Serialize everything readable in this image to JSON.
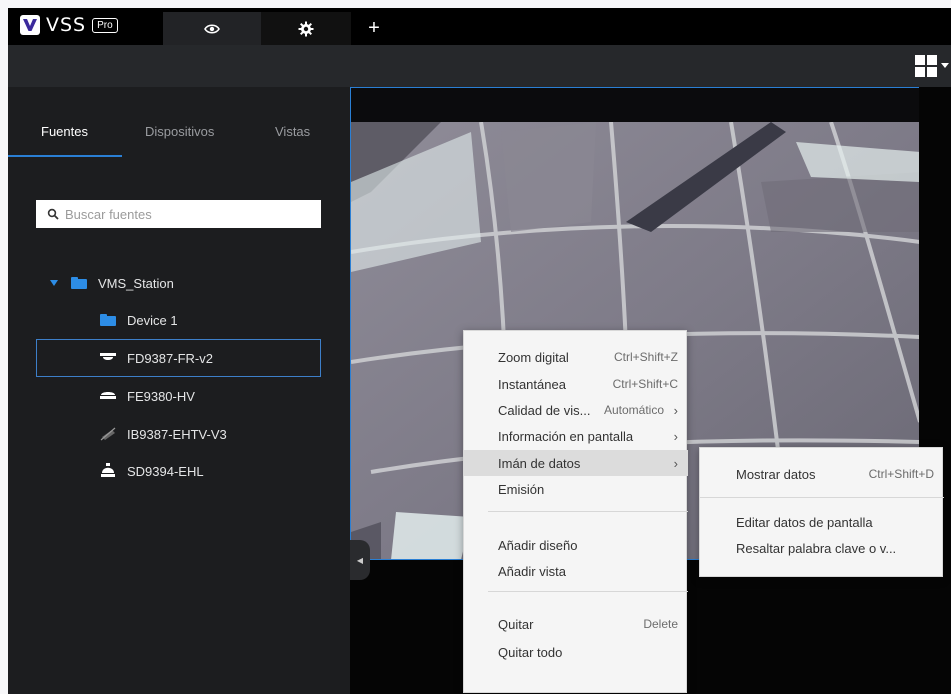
{
  "app": {
    "name": "VSS",
    "edition": "Pro"
  },
  "topbar": {
    "add_tab_label": "+"
  },
  "sidebar": {
    "tabs": [
      {
        "label": "Fuentes",
        "active": true
      },
      {
        "label": "Dispositivos",
        "active": false
      },
      {
        "label": "Vistas",
        "active": false
      }
    ],
    "search": {
      "placeholder": "Buscar fuentes",
      "value": ""
    },
    "tree": {
      "root": {
        "label": "VMS_Station",
        "expanded": true
      },
      "items": [
        {
          "label": "Device 1",
          "icon": "folder-icon"
        },
        {
          "label": "FD9387-FR-v2",
          "icon": "dome-camera-icon",
          "selected": true
        },
        {
          "label": "FE9380-HV",
          "icon": "fisheye-camera-icon"
        },
        {
          "label": "IB9387-EHTV-V3",
          "icon": "bullet-camera-offline-icon"
        },
        {
          "label": "SD9394-EHL",
          "icon": "speed-dome-camera-icon"
        }
      ]
    }
  },
  "context_menu": {
    "items": [
      {
        "label": "Zoom digital",
        "shortcut": "Ctrl+Shift+Z"
      },
      {
        "label": "Instantánea",
        "shortcut": "Ctrl+Shift+C"
      },
      {
        "label": "Calidad de vis...",
        "shortcut": "Automático",
        "has_submenu": true
      },
      {
        "label": "Información en pantalla",
        "has_submenu": true
      },
      {
        "label": "Imán de datos",
        "has_submenu": true,
        "highlighted": true
      },
      {
        "label": "Emisión"
      },
      {
        "label": "Añadir diseño"
      },
      {
        "label": "Añadir vista"
      },
      {
        "label": "Quitar",
        "shortcut": "Delete"
      },
      {
        "label": "Quitar todo"
      }
    ],
    "arrow": "›"
  },
  "submenu": {
    "items": [
      {
        "label": "Mostrar datos",
        "shortcut": "Ctrl+Shift+D"
      },
      {
        "label": "Editar datos de pantalla"
      },
      {
        "label": "Resaltar palabra clave o v..."
      }
    ]
  },
  "colors": {
    "accent": "#2a7fd4",
    "brand": "#3b2a9c",
    "sidebar_bg": "#1c1d1f",
    "menu_bg": "#f5f5f5"
  }
}
